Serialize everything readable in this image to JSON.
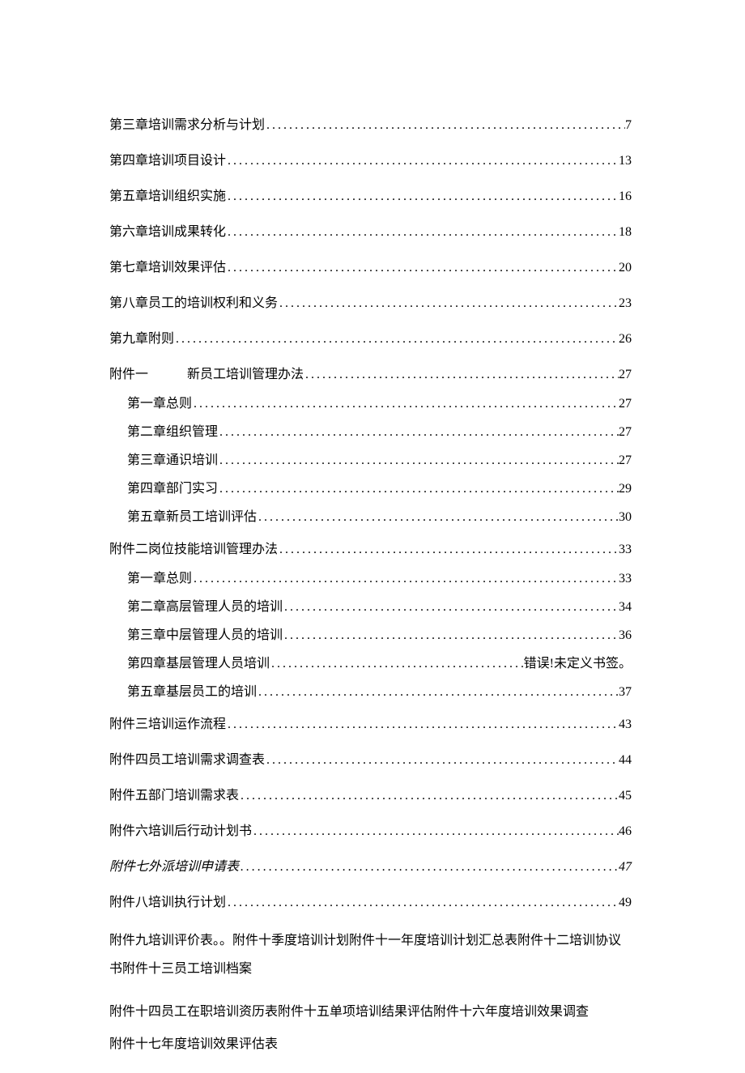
{
  "dots": "...............................................................................................................",
  "toc": {
    "main": [
      {
        "label": "第三章培训需求分析与计划",
        "page": "7"
      },
      {
        "label": "第四章培训项目设计",
        "page": "13"
      },
      {
        "label": "第五章培训组织实施",
        "page": "16"
      },
      {
        "label": "第六章培训成果转化",
        "page": "18"
      },
      {
        "label": "第七章培训效果评估",
        "page": "20"
      },
      {
        "label": "第八章员工的培训权利和义务",
        "page": "23"
      },
      {
        "label": "第九章附则",
        "page": "26"
      }
    ],
    "attach1": {
      "head": {
        "prefix": "附件一",
        "title": "新员工培训管理办法",
        "page": "27"
      },
      "sub": [
        {
          "label": "第一章总则",
          "page": "27"
        },
        {
          "label": "第二章组织管理",
          "page": "27"
        },
        {
          "label": "第三章通识培训",
          "page": "27"
        },
        {
          "label": "第四章部门实习",
          "page": "29"
        },
        {
          "label": "第五章新员工培训评估",
          "page": "30"
        }
      ]
    },
    "attach2": {
      "head": {
        "label": "附件二岗位技能培训管理办法",
        "page": "33"
      },
      "sub": [
        {
          "label": "第一章总则",
          "page": "33"
        },
        {
          "label": "第二章高层管理人员的培训",
          "page": "34"
        },
        {
          "label": "第三章中层管理人员的培训",
          "page": "36"
        },
        {
          "label": "第四章基层管理人员培训",
          "page": "错误!未定义书签。"
        },
        {
          "label": "第五章基层员工的培训",
          "page": "37"
        }
      ]
    },
    "rest": [
      {
        "label": "附件三培训运作流程",
        "page": "43",
        "italic": false
      },
      {
        "label": "附件四员工培训需求调查表",
        "page": "44",
        "italic": false
      },
      {
        "label": "附件五部门培训需求表",
        "page": "45",
        "italic": false
      },
      {
        "label": "附件六培训后行动计划书",
        "page": "46",
        "italic": false
      },
      {
        "label": "附件七外派培训申请表",
        "page": "47",
        "italic": true
      },
      {
        "label": "附件八培训执行计划",
        "page": "49",
        "italic": false
      }
    ],
    "para1": "附件九培训评价表。。附件十季度培训计划附件十一年度培训计划汇总表附件十二培训协议书附件十三员工培训档案",
    "para2": "附件十四员工在职培训资历表附件十五单项培训结果评估附件十六年度培训效果调查",
    "para3": "附件十七年度培训效果评估表"
  }
}
